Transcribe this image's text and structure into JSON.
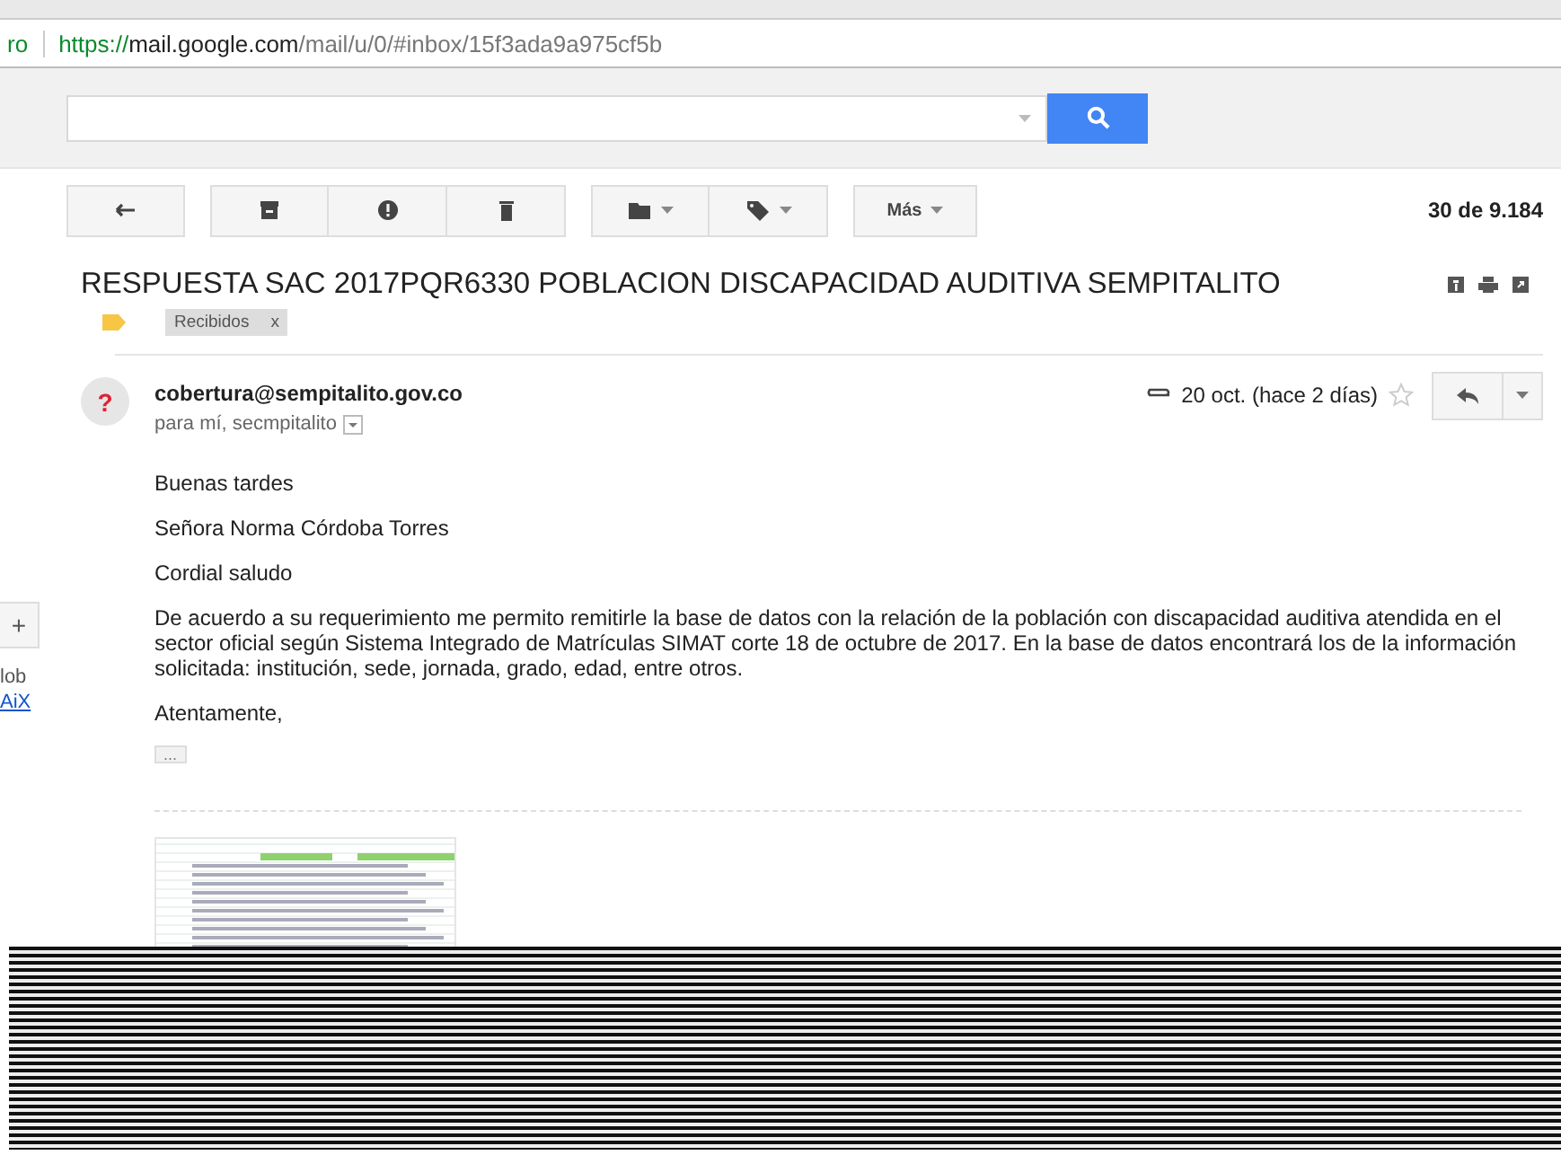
{
  "browser": {
    "url_fragment": "ro",
    "url": {
      "scheme": "https://",
      "host": "mail.google.com",
      "path": "/mail/u/0/#inbox/15f3ada9a975cf5b"
    }
  },
  "toolbar": {
    "more_label": "Más",
    "count": "30 de 9.184"
  },
  "side": {
    "button": "+",
    "fragments": [
      {
        "text": "lob",
        "kind": "text"
      },
      {
        "text": "AiX",
        "kind": "link"
      }
    ]
  },
  "message": {
    "subject": "RESPUESTA SAC 2017PQR6330 POBLACION DISCAPACIDAD AUDITIVA SEMPITALITO",
    "labels": [
      {
        "text": "Recibidos",
        "remove": "x"
      }
    ],
    "sender": "cobertura@sempitalito.gov.co",
    "avatar": "?",
    "recipients": "para mí, secmpitalito",
    "date": "20 oct. (hace 2 días)",
    "starred": false,
    "body": [
      "Buenas tardes",
      "Señora Norma Córdoba Torres",
      "Cordial saludo",
      "De acuerdo a su requerimiento me permito remitirle la base de datos con la relación de la población con discapacidad auditiva atendida en el sector oficial según Sistema Integrado de Matrículas SIMAT corte 18 de octubre de 2017. En la base de datos encontrará los de la información solicitada: institución, sede, jornada, grado, edad, entre otros.",
      "Atentamente,"
    ],
    "trimmed": "..."
  }
}
